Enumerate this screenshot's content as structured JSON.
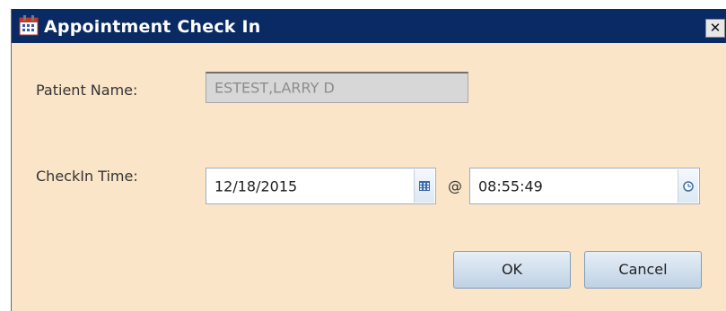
{
  "window": {
    "title": "Appointment Check In",
    "close_glyph": "✕",
    "icon": "calendar-app-icon"
  },
  "patient": {
    "label": "Patient Name:",
    "value": "ESTEST,LARRY D"
  },
  "checkin": {
    "label": "CheckIn Time:",
    "date": "12/18/2015",
    "at": "@",
    "time": "08:55:49",
    "date_picker_icon": "calendar-grid-icon",
    "time_picker_icon": "clock-icon"
  },
  "buttons": {
    "ok": "OK",
    "cancel": "Cancel"
  },
  "colors": {
    "titlebar": "#0a2a63",
    "dialog_background": "#fbe5c8",
    "readonly_field": "#d7d7d7"
  }
}
